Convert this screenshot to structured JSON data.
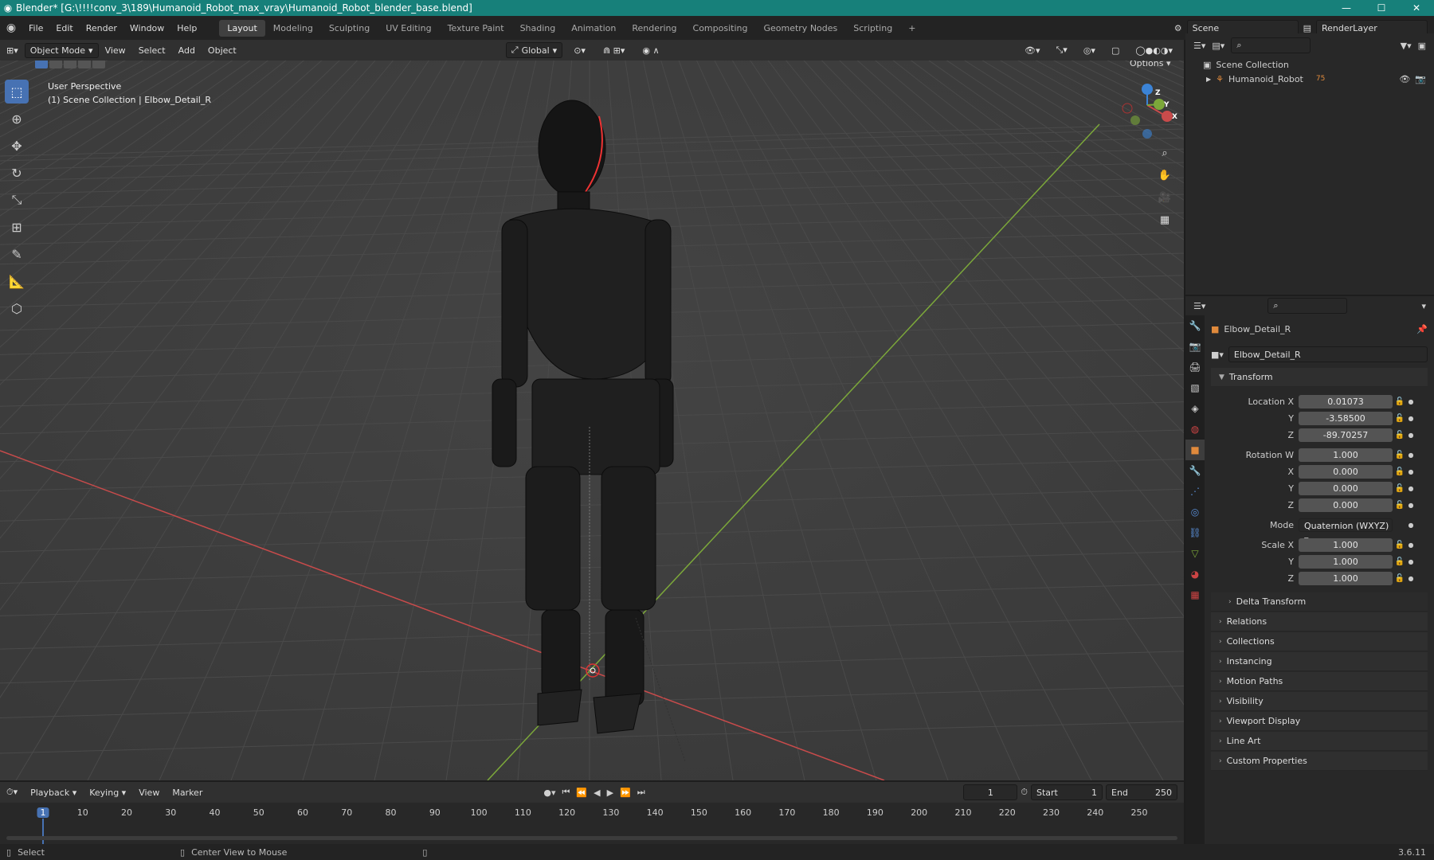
{
  "titlebar": {
    "title": "Blender* [G:\\!!!!conv_3\\189\\Humanoid_Robot_max_vray\\Humanoid_Robot_blender_base.blend]"
  },
  "menu": [
    "File",
    "Edit",
    "Render",
    "Window",
    "Help"
  ],
  "workspaces": [
    "Layout",
    "Modeling",
    "Sculpting",
    "UV Editing",
    "Texture Paint",
    "Shading",
    "Animation",
    "Rendering",
    "Compositing",
    "Geometry Nodes",
    "Scripting"
  ],
  "workspace_add": "+",
  "scene": {
    "name": "Scene",
    "render_layer": "RenderLayer"
  },
  "viewport_header": {
    "mode": "Object Mode",
    "menus": [
      "View",
      "Select",
      "Add",
      "Object"
    ],
    "orientation": "Global",
    "options": "Options"
  },
  "viewport": {
    "perspective": "User Perspective",
    "collection_info": "(1) Scene Collection | Elbow_Detail_R"
  },
  "gizmo": {
    "x": "X",
    "y": "Y",
    "z": "Z"
  },
  "outliner": {
    "root": "Scene Collection",
    "items": [
      {
        "name": "Humanoid_Robot",
        "badge": "75"
      }
    ]
  },
  "properties": {
    "object_name": "Elbow_Detail_R",
    "data_name": "Elbow_Detail_R",
    "transform_title": "Transform",
    "location": {
      "label": "Location X",
      "x": "0.01073",
      "y": "-3.58500",
      "z": "-89.70257"
    },
    "rotation": {
      "label": "Rotation W",
      "w": "1.000",
      "x": "0.000",
      "y": "0.000",
      "z": "0.000"
    },
    "mode": {
      "label": "Mode",
      "value": "Quaternion (WXYZ)"
    },
    "scale": {
      "label": "Scale X",
      "x": "1.000",
      "y": "1.000",
      "z": "1.000"
    },
    "axis_labels": {
      "x": "X",
      "y": "Y",
      "z": "Z"
    },
    "delta": "Delta Transform",
    "panels": [
      "Relations",
      "Collections",
      "Instancing",
      "Motion Paths",
      "Visibility",
      "Viewport Display",
      "Line Art",
      "Custom Properties"
    ]
  },
  "timeline": {
    "menus": [
      "Playback",
      "Keying",
      "View",
      "Marker"
    ],
    "current_frame": "1",
    "start_label": "Start",
    "start": "1",
    "end_label": "End",
    "end": "250",
    "ticks": [
      "1",
      "10",
      "20",
      "30",
      "40",
      "50",
      "60",
      "70",
      "80",
      "90",
      "100",
      "110",
      "120",
      "130",
      "140",
      "150",
      "160",
      "170",
      "180",
      "190",
      "200",
      "210",
      "220",
      "230",
      "240",
      "250"
    ]
  },
  "statusbar": {
    "select": "Select",
    "center": "Center View to Mouse",
    "version": "3.6.11"
  },
  "colors": {
    "accent": "#4772b3",
    "titlebar": "#17807a",
    "x_axis": "#c84b4b",
    "y_axis": "#7ca83a",
    "z_axis": "#3b83d6"
  }
}
